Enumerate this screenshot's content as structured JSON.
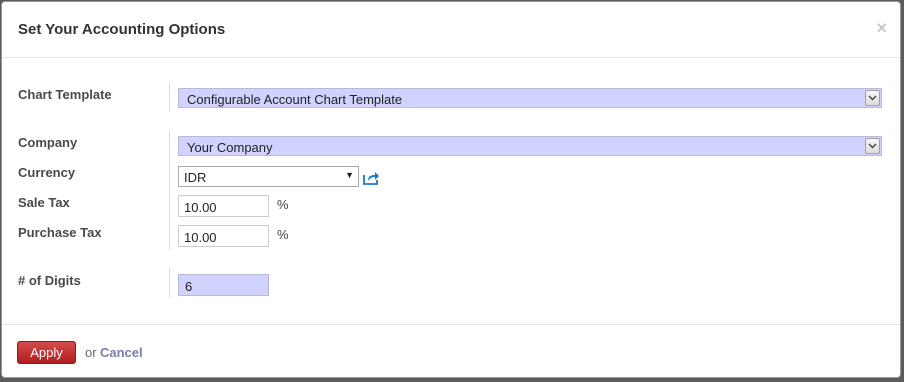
{
  "dialog": {
    "title": "Set Your Accounting Options",
    "close_glyph": "×"
  },
  "form": {
    "chart_template": {
      "label": "Chart Template",
      "value": "Configurable Account Chart Template"
    },
    "company": {
      "label": "Company",
      "value": "Your Company"
    },
    "currency": {
      "label": "Currency",
      "value": "IDR"
    },
    "sale_tax": {
      "label": "Sale Tax",
      "value": "10.00",
      "unit": "%"
    },
    "purchase_tax": {
      "label": "Purchase Tax",
      "value": "10.00",
      "unit": "%"
    },
    "digits": {
      "label": "# of Digits",
      "value": "6"
    }
  },
  "footer": {
    "apply_label": "Apply",
    "or_text": "or",
    "cancel_label": "Cancel"
  },
  "colors": {
    "required_field_bg": "#d2d2ff",
    "apply_button": "#c0392b",
    "cancel_link": "#7c7bad",
    "external_link_icon": "#1f7ac4"
  }
}
